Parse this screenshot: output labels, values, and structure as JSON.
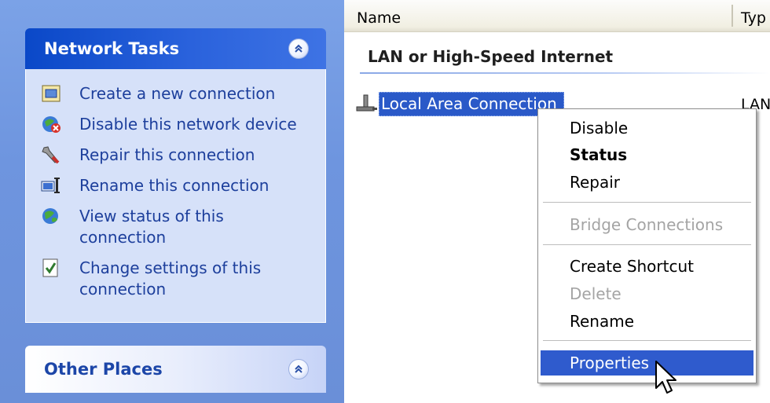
{
  "taskpane": {
    "network_tasks": {
      "title": "Network Tasks",
      "items": [
        {
          "label": "Create a new connection",
          "icon": "new-connection-icon"
        },
        {
          "label": "Disable this network device",
          "icon": "disable-device-icon"
        },
        {
          "label": "Repair this connection",
          "icon": "repair-icon"
        },
        {
          "label": "Rename this connection",
          "icon": "rename-icon"
        },
        {
          "label": "View status of this connection",
          "icon": "view-status-icon"
        },
        {
          "label": "Change settings of this connection",
          "icon": "change-settings-icon"
        }
      ]
    },
    "other_places": {
      "title": "Other Places"
    }
  },
  "listview": {
    "columns": {
      "name": "Name",
      "type": "Typ"
    },
    "group": "LAN or High-Speed Internet",
    "item": {
      "label": "Local Area Connection",
      "type": "LAN"
    }
  },
  "context_menu": {
    "disable": "Disable",
    "status": "Status",
    "repair": "Repair",
    "bridge": "Bridge Connections",
    "shortcut": "Create Shortcut",
    "delete": "Delete",
    "rename": "Rename",
    "properties": "Properties"
  },
  "colors": {
    "pane_blue": "#6e95df",
    "selection_blue": "#2a59c8",
    "task_link": "#1d3f9c"
  }
}
